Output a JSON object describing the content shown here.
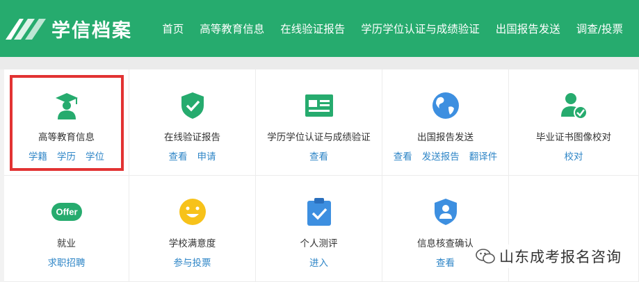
{
  "header": {
    "logo_text": "学信档案",
    "nav": [
      "首页",
      "高等教育信息",
      "在线验证报告",
      "学历学位认证与成绩验证",
      "出国报告发送",
      "调查/投票"
    ]
  },
  "tiles": [
    {
      "title": "高等教育信息",
      "links": [
        "学籍",
        "学历",
        "学位"
      ],
      "icon": "graduate-icon"
    },
    {
      "title": "在线验证报告",
      "links": [
        "查看",
        "申请"
      ],
      "icon": "shield-check-icon"
    },
    {
      "title": "学历学位认证与成绩验证",
      "links": [
        "查看"
      ],
      "icon": "id-card-icon"
    },
    {
      "title": "出国报告发送",
      "links": [
        "查看",
        "发送报告",
        "翻译件"
      ],
      "icon": "globe-icon"
    },
    {
      "title": "毕业证书图像校对",
      "links": [
        "校对"
      ],
      "icon": "user-check-icon"
    },
    {
      "title": "就业",
      "links": [
        "求职招聘"
      ],
      "icon": "offer-icon",
      "icon_text": "Offer"
    },
    {
      "title": "学校满意度",
      "links": [
        "参与投票"
      ],
      "icon": "smiley-icon"
    },
    {
      "title": "个人测评",
      "links": [
        "进入"
      ],
      "icon": "clipboard-check-icon"
    },
    {
      "title": "信息核查确认",
      "links": [
        "查看"
      ],
      "icon": "user-shield-icon"
    }
  ],
  "watermark": {
    "text": "山东成考报名咨询"
  },
  "colors": {
    "brand_green": "#26ab6e",
    "link_blue": "#2f86c7",
    "highlight_red": "#e23333",
    "icon_blue": "#3d8fe0",
    "icon_yellow": "#f7c21a"
  }
}
